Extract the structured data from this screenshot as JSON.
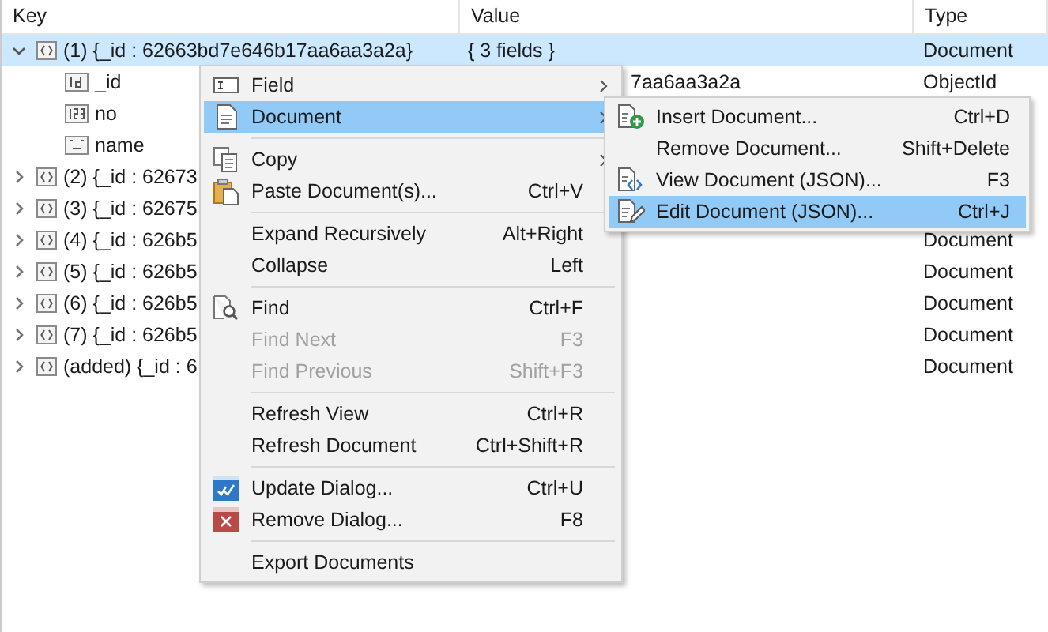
{
  "table": {
    "columns": [
      "Key",
      "Value",
      "Type"
    ],
    "rows": [
      {
        "kind": "document",
        "key": "(1) {_id : 62663bd7e646b17aa6aa3a2a}",
        "value": "{ 3 fields }",
        "type": "Document",
        "expanded": true,
        "selected": true,
        "children": [
          {
            "kind": "objectid",
            "key": "_id",
            "value": "7aa6aa3a2a",
            "type": "ObjectId",
            "selected": false
          },
          {
            "kind": "number",
            "key": "no",
            "selected": false
          },
          {
            "kind": "string",
            "key": "name",
            "selected": false
          }
        ]
      },
      {
        "kind": "document",
        "key": "(2) {_id : 62673",
        "expanded": false,
        "selected": false
      },
      {
        "kind": "document",
        "key": "(3) {_id : 62675",
        "expanded": false,
        "selected": false
      },
      {
        "kind": "document",
        "key": "(4) {_id : 626b5",
        "type": "Document",
        "expanded": false,
        "selected": false
      },
      {
        "kind": "document",
        "key": "(5) {_id : 626b5",
        "type": "Document",
        "expanded": false,
        "selected": false
      },
      {
        "kind": "document",
        "key": "(6) {_id : 626b5",
        "type": "Document",
        "expanded": false,
        "selected": false
      },
      {
        "kind": "document",
        "key": "(7) {_id : 626b5",
        "type": "Document",
        "expanded": false,
        "selected": false
      },
      {
        "kind": "document",
        "key": "(added) {_id : 6",
        "type": "Document",
        "expanded": false,
        "selected": false
      }
    ]
  },
  "context_menu": {
    "items": [
      {
        "kind": "item",
        "label": "Field",
        "submenu": true,
        "selected": false,
        "disabled": false
      },
      {
        "kind": "item",
        "label": "Document",
        "submenu": true,
        "selected": true,
        "disabled": false
      },
      {
        "kind": "separator"
      },
      {
        "kind": "item",
        "label": "Copy",
        "submenu": true,
        "selected": false,
        "disabled": false
      },
      {
        "kind": "item",
        "label": "Paste Document(s)...",
        "shortcut": "Ctrl+V",
        "selected": false,
        "disabled": false
      },
      {
        "kind": "separator"
      },
      {
        "kind": "item",
        "label": "Expand Recursively",
        "shortcut": "Alt+Right",
        "selected": false,
        "disabled": false
      },
      {
        "kind": "item",
        "label": "Collapse",
        "shortcut": "Left",
        "selected": false,
        "disabled": false
      },
      {
        "kind": "separator"
      },
      {
        "kind": "item",
        "label": "Find",
        "shortcut": "Ctrl+F",
        "selected": false,
        "disabled": false
      },
      {
        "kind": "item",
        "label": "Find Next",
        "shortcut": "F3",
        "selected": false,
        "disabled": true
      },
      {
        "kind": "item",
        "label": "Find Previous",
        "shortcut": "Shift+F3",
        "selected": false,
        "disabled": true
      },
      {
        "kind": "separator"
      },
      {
        "kind": "item",
        "label": "Refresh View",
        "shortcut": "Ctrl+R",
        "selected": false,
        "disabled": false
      },
      {
        "kind": "item",
        "label": "Refresh Document",
        "shortcut": "Ctrl+Shift+R",
        "selected": false,
        "disabled": false
      },
      {
        "kind": "separator"
      },
      {
        "kind": "item",
        "label": "Update Dialog...",
        "shortcut": "Ctrl+U",
        "selected": false,
        "disabled": false
      },
      {
        "kind": "item",
        "label": "Remove Dialog...",
        "shortcut": "F8",
        "selected": false,
        "disabled": false
      },
      {
        "kind": "separator"
      },
      {
        "kind": "item",
        "label": "Export Documents",
        "selected": false,
        "disabled": false
      }
    ]
  },
  "submenu": {
    "items": [
      {
        "kind": "item",
        "label": "Insert Document...",
        "shortcut": "Ctrl+D",
        "selected": false
      },
      {
        "kind": "item",
        "label": "Remove Document...",
        "shortcut": "Shift+Delete",
        "selected": false
      },
      {
        "kind": "item",
        "label": "View Document (JSON)...",
        "shortcut": "F3",
        "selected": false
      },
      {
        "kind": "item",
        "label": "Edit Document (JSON)...",
        "shortcut": "Ctrl+J",
        "selected": true
      }
    ]
  }
}
